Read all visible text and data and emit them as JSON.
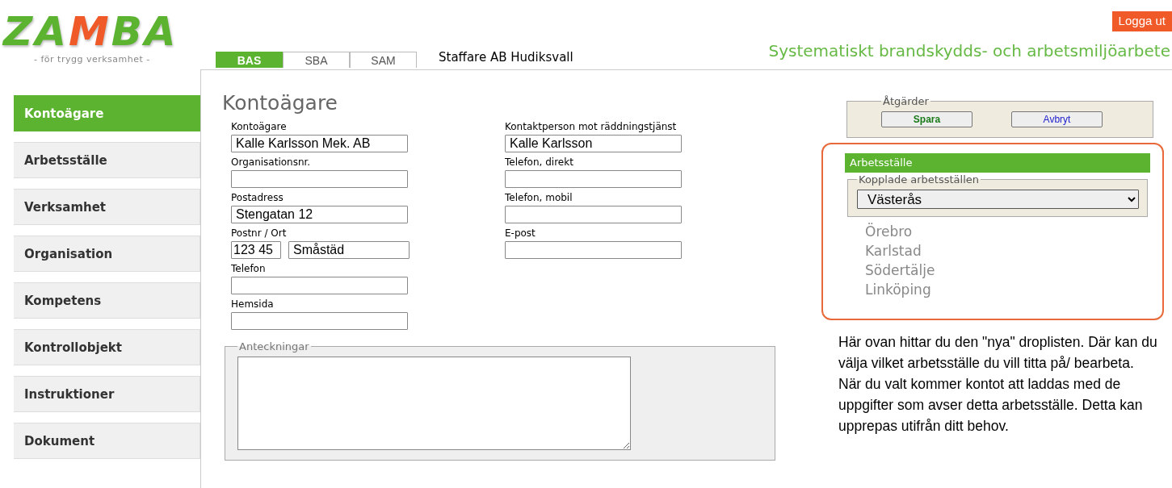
{
  "logo": {
    "text": "ZAMBA",
    "tagline": "- för trygg verksamhet -"
  },
  "header": {
    "logout": "Logga ut",
    "company": "Staffare AB Hudiksvall",
    "slogan": "Systematiskt brandskydds- och arbetsmiljöarbete"
  },
  "tabs": [
    {
      "label": "BAS",
      "selected": true
    },
    {
      "label": "SBA",
      "selected": false
    },
    {
      "label": "SAM",
      "selected": false
    }
  ],
  "sidebar": {
    "items": [
      {
        "label": "Kontoägare",
        "selected": true
      },
      {
        "label": "Arbetsställe",
        "selected": false
      },
      {
        "label": "Verksamhet",
        "selected": false
      },
      {
        "label": "Organisation",
        "selected": false
      },
      {
        "label": "Kompetens",
        "selected": false
      },
      {
        "label": "Kontrollobjekt",
        "selected": false
      },
      {
        "label": "Instruktioner",
        "selected": false
      },
      {
        "label": "Dokument",
        "selected": false
      }
    ]
  },
  "form": {
    "title": "Kontoägare",
    "left_fields": [
      {
        "label": "Kontoägare",
        "values": [
          "Kalle Karlsson Mek. AB"
        ]
      },
      {
        "label": "Organisationsnr."
      },
      {
        "label": "Postadress",
        "values": [
          "Stengatan 12"
        ]
      },
      {
        "label": "Postnr / Ort",
        "values": [
          "123 45",
          "Småstäd"
        ]
      },
      {
        "label": "Telefon"
      },
      {
        "label": "Hemsida"
      }
    ],
    "right_fields": [
      {
        "label": "Kontaktperson mot räddningstjänst",
        "values": [
          "Kalle Karlsson"
        ]
      },
      {
        "label": "Telefon, direkt"
      },
      {
        "label": "Telefon, mobil"
      },
      {
        "label": "E-post"
      }
    ],
    "notes": {
      "legend": "Anteckningar"
    }
  },
  "actions": {
    "legend": "Åtgärder",
    "buttons": [
      {
        "label": "Spara",
        "kind": "primary"
      },
      {
        "label": "Avbryt",
        "kind": "secondary"
      }
    ]
  },
  "workplace": {
    "title": "Arbetsställe",
    "legend": "Kopplade arbetsställen",
    "selected": "Västerås",
    "options_shown": [
      "Örebro",
      "Karlstad",
      "Södertälje",
      "Linköping"
    ]
  },
  "explanation": [
    "Här ovan hittar du den \"nya\" droplisten. Där kan du välja vilket arbetsställe du vill titta på/ bearbeta.",
    "När du valt kommer kontot att laddas med de uppgifter som avser detta arbetsställe. Detta kan upprepas utifrån ditt behov."
  ]
}
